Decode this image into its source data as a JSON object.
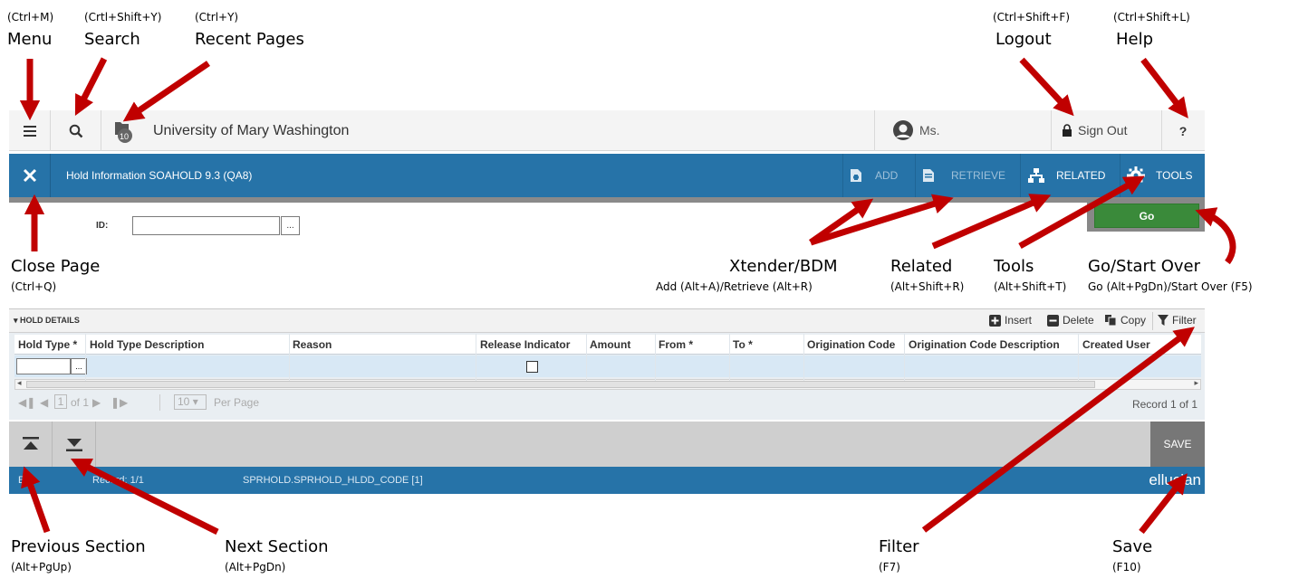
{
  "annotations": {
    "menu": {
      "shortcut": "(Ctrl+M)",
      "label": "Menu"
    },
    "search": {
      "shortcut": "(Crtl+Shift+Y)",
      "label": "Search"
    },
    "recent": {
      "shortcut": "(Ctrl+Y)",
      "label": "Recent Pages"
    },
    "logout": {
      "shortcut": "(Ctrl+Shift+F)",
      "label": "Logout"
    },
    "help": {
      "shortcut": "(Ctrl+Shift+L)",
      "label": "Help"
    },
    "close": {
      "label": "Close Page",
      "shortcut": "(Ctrl+Q)"
    },
    "xtender": {
      "label": "Xtender/BDM",
      "shortcut": "Add (Alt+A)/Retrieve (Alt+R)"
    },
    "related": {
      "label": "Related",
      "shortcut": "(Alt+Shift+R)"
    },
    "tools": {
      "label": "Tools",
      "shortcut": "(Alt+Shift+T)"
    },
    "go": {
      "label": "Go/Start Over",
      "shortcut": "Go (Alt+PgDn)/Start Over (F5)"
    },
    "prev": {
      "label": "Previous Section",
      "shortcut": "(Alt+PgUp)"
    },
    "next": {
      "label": "Next Section",
      "shortcut": "(Alt+PgDn)"
    },
    "filter": {
      "label": "Filter",
      "shortcut": "(F7)"
    },
    "save": {
      "label": "Save",
      "shortcut": "(F10)"
    }
  },
  "topbar": {
    "recent_count": "10",
    "institution": "University of Mary Washington",
    "user": "Ms.",
    "sign_out": "Sign Out",
    "help": "?"
  },
  "header": {
    "page_title": "Hold Information SOAHOLD 9.3 (QA8)",
    "add": "ADD",
    "retrieve": "RETRIEVE",
    "related": "RELATED",
    "tools": "TOOLS"
  },
  "key_block": {
    "id_label": "ID:",
    "id_value": "",
    "lookup": "...",
    "go": "Go"
  },
  "section": {
    "title": "HOLD DETAILS",
    "actions": {
      "insert": "Insert",
      "delete": "Delete",
      "copy": "Copy",
      "filter": "Filter"
    },
    "columns": [
      "Hold Type *",
      "Hold Type Description",
      "Reason",
      "Release Indicator",
      "Amount",
      "From *",
      "To *",
      "Origination Code",
      "Origination Code Description",
      "Created User"
    ],
    "row_lookup": "...",
    "pager": {
      "page": "1",
      "of": "of 1",
      "per_page_value": "10",
      "per_page": "Per Page",
      "record": "Record 1 of 1"
    }
  },
  "footer": {
    "save": "SAVE",
    "status_left": "E",
    "record": "Record: 1/1",
    "field": "SPRHOLD.SPRHOLD_HLDD_CODE [1]",
    "brand": "ellucian"
  },
  "colors": {
    "header_blue": "#2673a8",
    "arrow_red": "#c00000",
    "go_green": "#3a8a3a"
  }
}
